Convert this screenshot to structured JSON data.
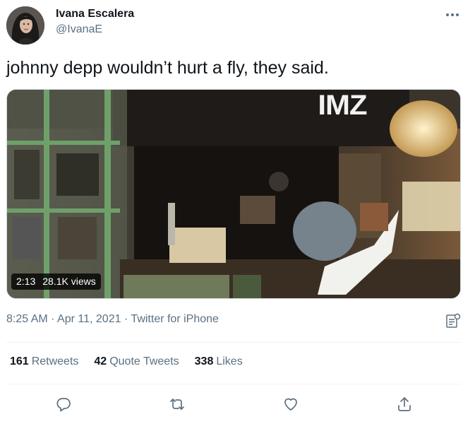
{
  "author": {
    "name": "Ivana Escalera",
    "handle": "@IvanaE"
  },
  "tweet": {
    "text": "johnny depp wouldn’t hurt a fly, they said."
  },
  "media": {
    "watermark": "IMZ",
    "duration": "2:13",
    "views": "28.1K views"
  },
  "meta": {
    "time": "8:25 AM",
    "separator1": " · ",
    "date": "Apr 11, 2021",
    "separator2": " · ",
    "source": "Twitter for iPhone"
  },
  "stats": {
    "retweets_count": "161",
    "retweets_label": "Retweets",
    "quotes_count": "42",
    "quotes_label": "Quote Tweets",
    "likes_count": "338",
    "likes_label": "Likes"
  },
  "icons": {
    "more": "more-icon",
    "analytics": "analytics-icon",
    "reply": "reply-icon",
    "retweet": "retweet-icon",
    "like": "like-icon",
    "share": "share-icon"
  },
  "colors": {
    "text": "#0f1419",
    "secondary": "#5b7083",
    "divider": "#eff3f4"
  }
}
